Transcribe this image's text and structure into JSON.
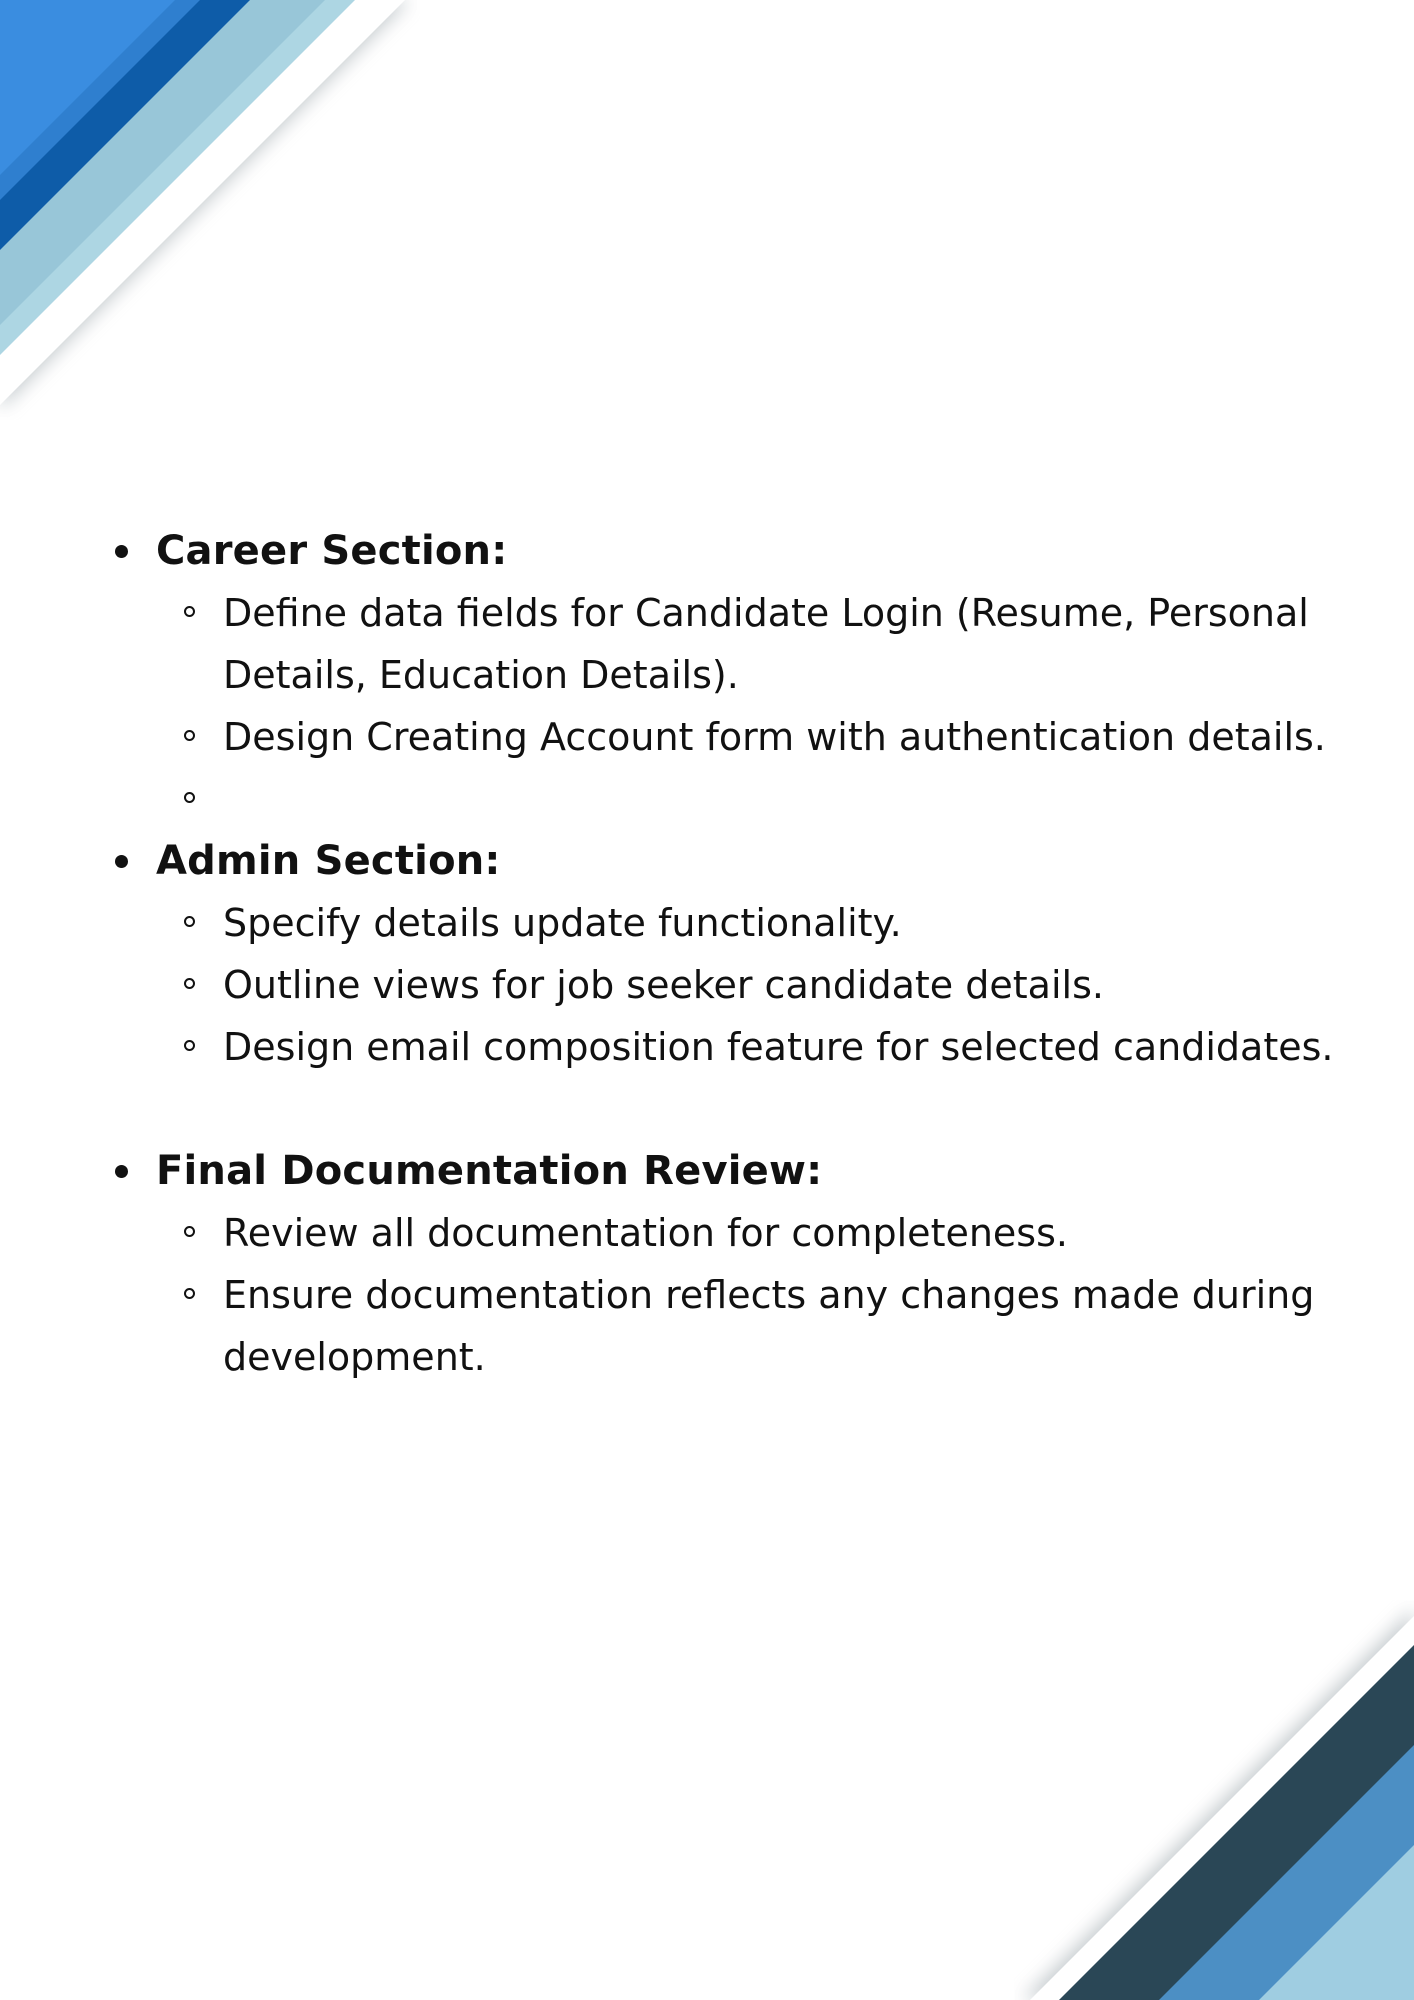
{
  "document": {
    "accent_colors": {
      "blue_bright": "#3a8de0",
      "blue_dark": "#0e5ca8",
      "blue_light": "#add6e3",
      "navy": "#2a4756",
      "steel_blue": "#4c8fc4",
      "sky": "#9fcde1"
    },
    "sections": [
      {
        "title": "Career Section:",
        "items": [
          "Define data fields for Candidate Login (Resume, Personal Details, Education Details).",
          "Design Creating Account form with authentication details.",
          ""
        ]
      },
      {
        "title": "Admin Section:",
        "items": [
          "Specify details update functionality.",
          "Outline views for job seeker candidate details.",
          "Design email composition feature for selected candidates."
        ]
      },
      {
        "title": "Final Documentation Review:",
        "items": [
          "Review all documentation for completeness.",
          "Ensure documentation reflects any changes made during development."
        ]
      }
    ]
  }
}
